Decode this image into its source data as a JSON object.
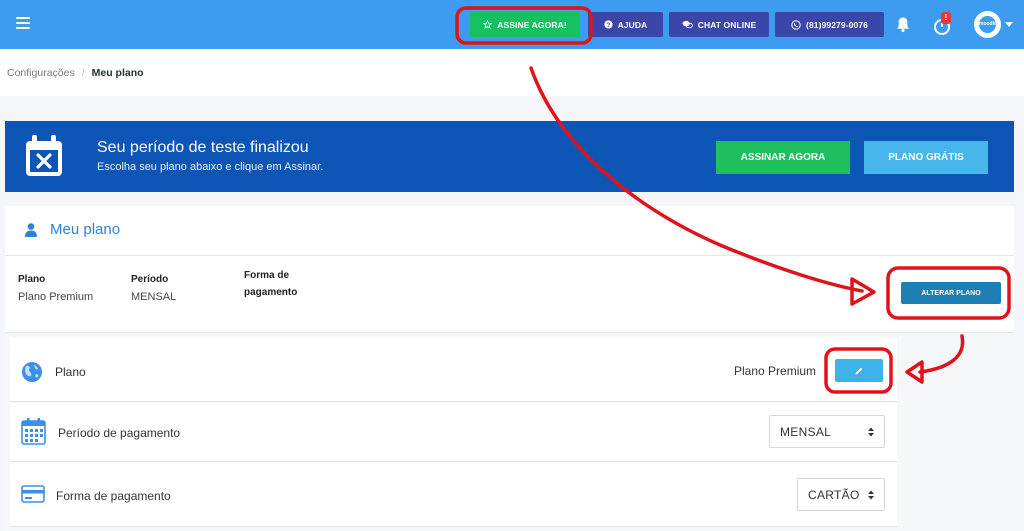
{
  "topbar": {
    "assine_label": "ASSINE AGORA!",
    "ajuda_label": "AJUDA",
    "chat_label": "CHAT ONLINE",
    "phone_label": "(81)99279-0076",
    "notification_badge": "!",
    "avatar_text": "moodle"
  },
  "breadcrumb": {
    "parent": "Configurações",
    "separator": "/",
    "current": "Meu plano"
  },
  "banner": {
    "title": "Seu período de teste finalizou",
    "subtitle": "Escolha seu plano abaixo e clique em Assinar.",
    "assinar_label": "ASSINAR AGORA",
    "gratis_label": "PLANO GRÁTIS"
  },
  "card": {
    "title": "Meu plano",
    "info": {
      "plano_label": "Plano",
      "plano_value": "Plano Premium",
      "periodo_label": "Período",
      "periodo_value": "MENSAL",
      "forma_label_line1": "Forma de",
      "forma_label_line2": "pagamento"
    },
    "alterar_label": "ALTERAR PLANO"
  },
  "settings": {
    "plano": {
      "label": "Plano",
      "value": "Plano Premium"
    },
    "periodo": {
      "label": "Período de pagamento",
      "selected": "MENSAL"
    },
    "forma": {
      "label": "Forma de pagamento",
      "selected": "CARTÃO"
    }
  },
  "colors": {
    "topbar": "#3d9cf0",
    "banner": "#0e56b6",
    "green": "#17c160",
    "annotation": "#e0131b"
  }
}
